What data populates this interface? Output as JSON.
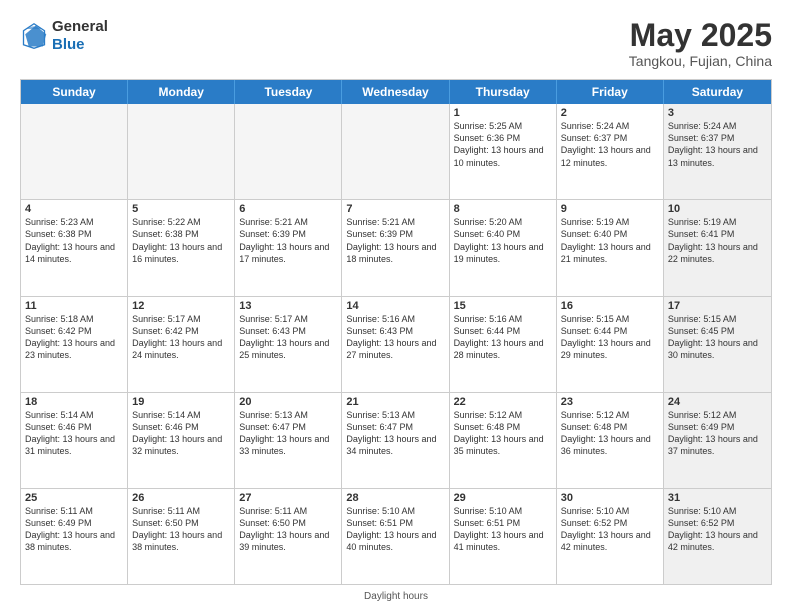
{
  "header": {
    "logo_line1": "General",
    "logo_line2": "Blue",
    "month_title": "May 2025",
    "location": "Tangkou, Fujian, China"
  },
  "day_headers": [
    "Sunday",
    "Monday",
    "Tuesday",
    "Wednesday",
    "Thursday",
    "Friday",
    "Saturday"
  ],
  "weeks": [
    [
      {
        "num": "",
        "info": "",
        "empty": true
      },
      {
        "num": "",
        "info": "",
        "empty": true
      },
      {
        "num": "",
        "info": "",
        "empty": true
      },
      {
        "num": "",
        "info": "",
        "empty": true
      },
      {
        "num": "1",
        "info": "Sunrise: 5:25 AM\nSunset: 6:36 PM\nDaylight: 13 hours\nand 10 minutes."
      },
      {
        "num": "2",
        "info": "Sunrise: 5:24 AM\nSunset: 6:37 PM\nDaylight: 13 hours\nand 12 minutes."
      },
      {
        "num": "3",
        "info": "Sunrise: 5:24 AM\nSunset: 6:37 PM\nDaylight: 13 hours\nand 13 minutes.",
        "shaded": true
      }
    ],
    [
      {
        "num": "4",
        "info": "Sunrise: 5:23 AM\nSunset: 6:38 PM\nDaylight: 13 hours\nand 14 minutes."
      },
      {
        "num": "5",
        "info": "Sunrise: 5:22 AM\nSunset: 6:38 PM\nDaylight: 13 hours\nand 16 minutes."
      },
      {
        "num": "6",
        "info": "Sunrise: 5:21 AM\nSunset: 6:39 PM\nDaylight: 13 hours\nand 17 minutes."
      },
      {
        "num": "7",
        "info": "Sunrise: 5:21 AM\nSunset: 6:39 PM\nDaylight: 13 hours\nand 18 minutes."
      },
      {
        "num": "8",
        "info": "Sunrise: 5:20 AM\nSunset: 6:40 PM\nDaylight: 13 hours\nand 19 minutes."
      },
      {
        "num": "9",
        "info": "Sunrise: 5:19 AM\nSunset: 6:40 PM\nDaylight: 13 hours\nand 21 minutes."
      },
      {
        "num": "10",
        "info": "Sunrise: 5:19 AM\nSunset: 6:41 PM\nDaylight: 13 hours\nand 22 minutes.",
        "shaded": true
      }
    ],
    [
      {
        "num": "11",
        "info": "Sunrise: 5:18 AM\nSunset: 6:42 PM\nDaylight: 13 hours\nand 23 minutes."
      },
      {
        "num": "12",
        "info": "Sunrise: 5:17 AM\nSunset: 6:42 PM\nDaylight: 13 hours\nand 24 minutes."
      },
      {
        "num": "13",
        "info": "Sunrise: 5:17 AM\nSunset: 6:43 PM\nDaylight: 13 hours\nand 25 minutes."
      },
      {
        "num": "14",
        "info": "Sunrise: 5:16 AM\nSunset: 6:43 PM\nDaylight: 13 hours\nand 27 minutes."
      },
      {
        "num": "15",
        "info": "Sunrise: 5:16 AM\nSunset: 6:44 PM\nDaylight: 13 hours\nand 28 minutes."
      },
      {
        "num": "16",
        "info": "Sunrise: 5:15 AM\nSunset: 6:44 PM\nDaylight: 13 hours\nand 29 minutes."
      },
      {
        "num": "17",
        "info": "Sunrise: 5:15 AM\nSunset: 6:45 PM\nDaylight: 13 hours\nand 30 minutes.",
        "shaded": true
      }
    ],
    [
      {
        "num": "18",
        "info": "Sunrise: 5:14 AM\nSunset: 6:46 PM\nDaylight: 13 hours\nand 31 minutes."
      },
      {
        "num": "19",
        "info": "Sunrise: 5:14 AM\nSunset: 6:46 PM\nDaylight: 13 hours\nand 32 minutes."
      },
      {
        "num": "20",
        "info": "Sunrise: 5:13 AM\nSunset: 6:47 PM\nDaylight: 13 hours\nand 33 minutes."
      },
      {
        "num": "21",
        "info": "Sunrise: 5:13 AM\nSunset: 6:47 PM\nDaylight: 13 hours\nand 34 minutes."
      },
      {
        "num": "22",
        "info": "Sunrise: 5:12 AM\nSunset: 6:48 PM\nDaylight: 13 hours\nand 35 minutes."
      },
      {
        "num": "23",
        "info": "Sunrise: 5:12 AM\nSunset: 6:48 PM\nDaylight: 13 hours\nand 36 minutes."
      },
      {
        "num": "24",
        "info": "Sunrise: 5:12 AM\nSunset: 6:49 PM\nDaylight: 13 hours\nand 37 minutes.",
        "shaded": true
      }
    ],
    [
      {
        "num": "25",
        "info": "Sunrise: 5:11 AM\nSunset: 6:49 PM\nDaylight: 13 hours\nand 38 minutes."
      },
      {
        "num": "26",
        "info": "Sunrise: 5:11 AM\nSunset: 6:50 PM\nDaylight: 13 hours\nand 38 minutes."
      },
      {
        "num": "27",
        "info": "Sunrise: 5:11 AM\nSunset: 6:50 PM\nDaylight: 13 hours\nand 39 minutes."
      },
      {
        "num": "28",
        "info": "Sunrise: 5:10 AM\nSunset: 6:51 PM\nDaylight: 13 hours\nand 40 minutes."
      },
      {
        "num": "29",
        "info": "Sunrise: 5:10 AM\nSunset: 6:51 PM\nDaylight: 13 hours\nand 41 minutes."
      },
      {
        "num": "30",
        "info": "Sunrise: 5:10 AM\nSunset: 6:52 PM\nDaylight: 13 hours\nand 42 minutes."
      },
      {
        "num": "31",
        "info": "Sunrise: 5:10 AM\nSunset: 6:52 PM\nDaylight: 13 hours\nand 42 minutes.",
        "shaded": true
      }
    ]
  ],
  "footer": {
    "daylight_label": "Daylight hours"
  }
}
